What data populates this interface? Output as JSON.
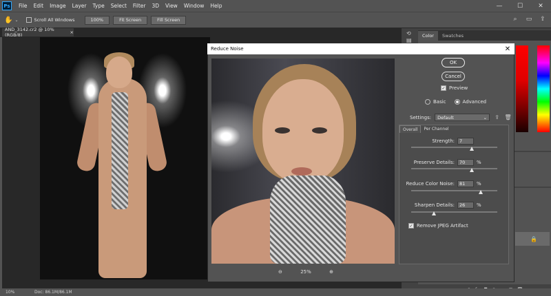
{
  "app": {
    "logo": "Ps"
  },
  "menu": [
    "File",
    "Edit",
    "Image",
    "Layer",
    "Type",
    "Select",
    "Filter",
    "3D",
    "View",
    "Window",
    "Help"
  ],
  "window_controls": {
    "minimize": "—",
    "maximize": "☐",
    "close": "✕"
  },
  "options_bar": {
    "scroll_all_windows": "Scroll All Windows",
    "zoom_100": "100%",
    "fit_screen": "Fit Screen",
    "fill_screen": "Fill Screen"
  },
  "document": {
    "tab_label": "AND_3142.cr2 @ 10% (RGB/8)",
    "close": "×"
  },
  "panels": {
    "tab_color": "Color",
    "tab_swatches": "Swatches"
  },
  "status_bar": {
    "zoom": "10%",
    "doc": "Doc: 86.1M/86.1M"
  },
  "dialog": {
    "title": "Reduce Noise",
    "close": "✕",
    "ok": "OK",
    "cancel": "Cancel",
    "preview_label": "Preview",
    "preview_checked": true,
    "mode_basic": "Basic",
    "mode_advanced": "Advanced",
    "mode_selected": "Advanced",
    "settings_label": "Settings:",
    "settings_value": "Default",
    "tab_overall": "Overall",
    "tab_per_channel": "Per Channel",
    "zoom_percent": "25%",
    "params": {
      "strength": {
        "label": "Strength:",
        "value": "7",
        "unit": "",
        "level": 0.7
      },
      "preserve_details": {
        "label": "Preserve Details:",
        "value": "70",
        "unit": "%",
        "level": 0.7
      },
      "reduce_color_noise": {
        "label": "Reduce Color Noise:",
        "value": "81",
        "unit": "%",
        "level": 0.81
      },
      "sharpen_details": {
        "label": "Sharpen Details:",
        "value": "26",
        "unit": "%",
        "level": 0.26
      }
    },
    "remove_jpeg_label": "Remove JPEG Artifact",
    "remove_jpeg_checked": true
  }
}
